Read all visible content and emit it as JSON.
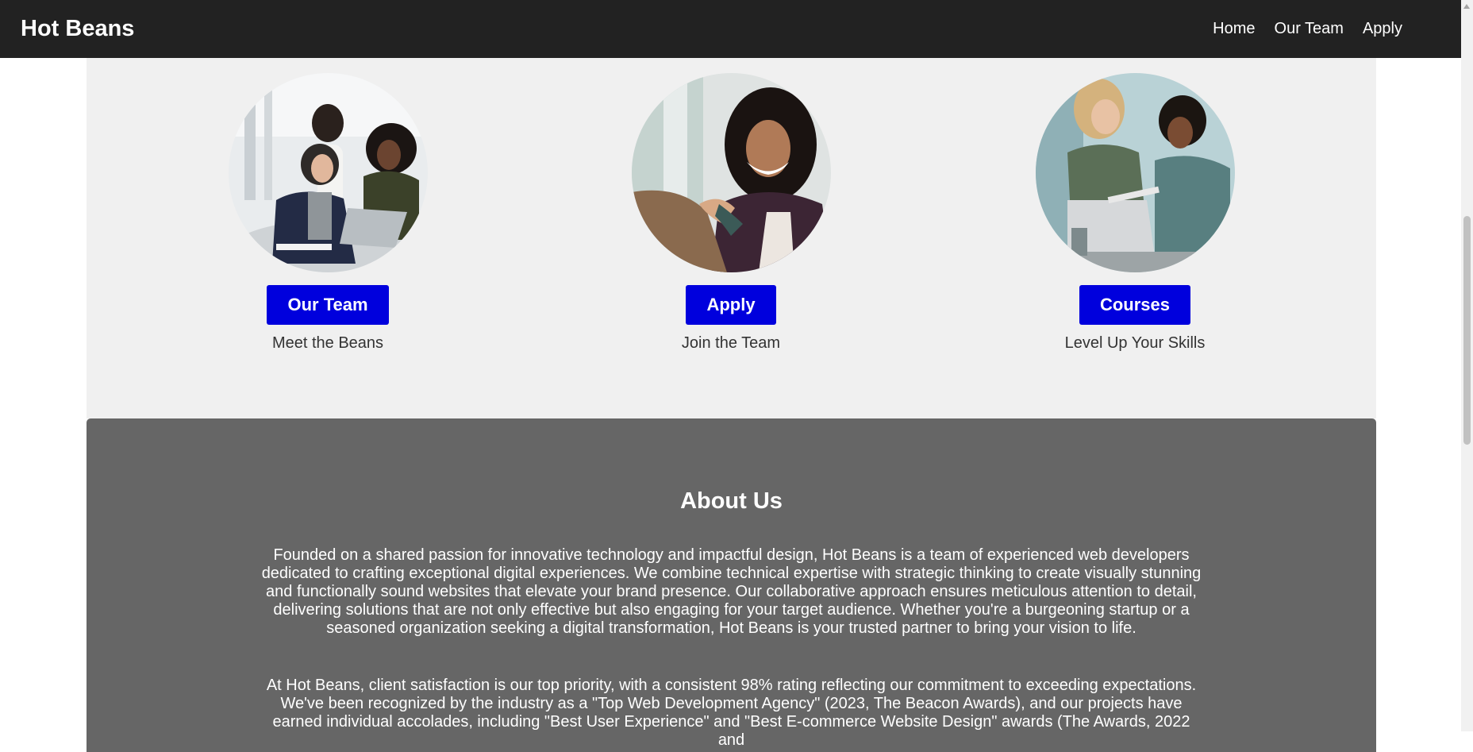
{
  "nav": {
    "brand": "Hot Beans",
    "links": [
      "Home",
      "Our Team",
      "Apply"
    ]
  },
  "cards": [
    {
      "button": "Our Team",
      "subtitle": "Meet the Beans",
      "image": "team-meeting-photo"
    },
    {
      "button": "Apply",
      "subtitle": "Join the Team",
      "image": "handshake-photo"
    },
    {
      "button": "Courses",
      "subtitle": "Level Up Your Skills",
      "image": "learning-laptop-photo"
    }
  ],
  "about": {
    "title": "About Us",
    "p1": "Founded on a shared passion for innovative technology and impactful design, Hot Beans is a team of experienced web developers dedicated to crafting exceptional digital experiences. We combine technical expertise with strategic thinking to create visually stunning and functionally sound websites that elevate your brand presence. Our collaborative approach ensures meticulous attention to detail, delivering solutions that are not only effective but also engaging for your target audience. Whether you're a burgeoning startup or a seasoned organization seeking a digital transformation, Hot Beans is your trusted partner to bring your vision to life.",
    "p2": "At Hot Beans, client satisfaction is our top priority, with a consistent 98% rating reflecting our commitment to exceeding expectations. We've been recognized by the industry as a \"Top Web Development Agency\" (2023, The Beacon Awards), and our projects have earned individual accolades, including \"Best User Experience\" and \"Best E-commerce Website Design\" awards (The Awards, 2022 and"
  },
  "colors": {
    "navbar": "#222222",
    "button": "#0000dd",
    "cards_bg": "#f0f0f0",
    "about_bg": "#666666"
  }
}
